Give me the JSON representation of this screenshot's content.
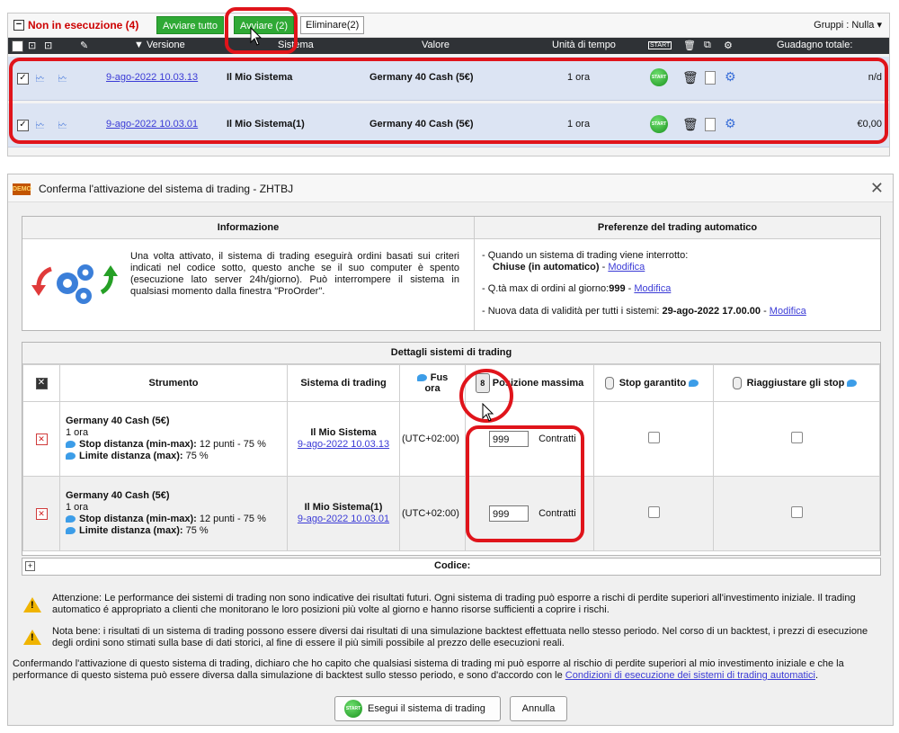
{
  "top": {
    "section_title": "Non in esecuzione (4)",
    "btn_start_all": "Avviare tutto",
    "btn_start": "Avviare (2)",
    "btn_delete": "Eliminare(2)",
    "groups": "Gruppi : Nulla",
    "columns": {
      "version": "▼ Versione",
      "system": "Sistema",
      "value": "Valore",
      "timeframe": "Unità di tempo",
      "start": "START",
      "gain": "Guadagno totale:"
    },
    "rows": [
      {
        "date": "9-ago-2022 10.03.13",
        "system": "Il Mio Sistema",
        "instrument": "Germany 40 Cash (5€)",
        "timeframe": "1 ora",
        "gain": "n/d"
      },
      {
        "date": "9-ago-2022 10.03.01",
        "system": "Il Mio Sistema(1)",
        "instrument": "Germany 40 Cash (5€)",
        "timeframe": "1 ora",
        "gain": "€0,00"
      }
    ]
  },
  "dialog": {
    "title": "Conferma l'attivazione del sistema di trading - ZHTBJ",
    "demo_label": "DEMO",
    "info": {
      "header": "Informazione",
      "text": "Una volta attivato, il sistema di trading eseguirà ordini basati sui criteri indicati nel codice sotto, questo anche se il suo computer è spento (esecuzione lato server 24h/giorno). Può interrompere il sistema in qualsiasi momento dalla finestra \"ProOrder\"."
    },
    "prefs": {
      "header": "Preferenze del trading automatico",
      "line1": "- Quando un sistema di trading viene interrotto:",
      "line1_value": "Chiuse (in automatico)",
      "line2_prefix": "- Q.tà max di ordini al giorno:",
      "line2_value": "999",
      "line3_prefix": "- Nuova data di validità per tutti i sistemi:",
      "line3_value": "29-ago-2022 17.00.00",
      "sep": " - ",
      "modify": "Modifica"
    },
    "details": {
      "header": "Dettagli sistemi di trading",
      "col_instrument": "Strumento",
      "col_system": "Sistema di trading",
      "col_tz_a": "Fus",
      "col_tz_b": "ora",
      "col_max_pos": "Posizione massima",
      "col_stop": "Stop garantito",
      "col_adjust": "Riaggiustare gli stop",
      "rows": [
        {
          "instrument": "Germany 40 Cash (5€)",
          "tf": "1 ora",
          "stop_label": "Stop distanza (min-max):",
          "stop_value": "12 punti - 75 %",
          "limit_label": "Limite distanza (max):",
          "limit_value": "75 %",
          "system": "Il Mio Sistema",
          "date": "9-ago-2022 10.03.13",
          "tz": "(UTC+02:00)",
          "max_pos": "999",
          "unit": "Contratti"
        },
        {
          "instrument": "Germany 40 Cash (5€)",
          "tf": "1 ora",
          "stop_label": "Stop distanza (min-max):",
          "stop_value": "12 punti - 75 %",
          "limit_label": "Limite distanza (max):",
          "limit_value": "75 %",
          "system": "Il Mio Sistema(1)",
          "date": "9-ago-2022 10.03.01",
          "tz": "(UTC+02:00)",
          "max_pos": "999",
          "unit": "Contratti"
        }
      ],
      "code_label": "Codice:"
    },
    "warning1": "Attenzione: Le performance dei sistemi di trading non sono indicative dei risultati futuri. Ogni sistema di trading può esporre a rischi di perdite superiori all'investimento iniziale. Il trading automatico é appropriato a clienti che monitorano le loro posizioni più volte al giorno e hanno risorse sufficienti a coprire i rischi.",
    "warning2": "Nota bene: i risultati di un sistema di trading possono essere diversi dai risultati di una simulazione backtest effettuata nello stesso periodo. Nel corso di un backtest, i prezzi di esecuzione degli ordini sono stimati sulla base di dati storici, al fine di essere il più simili possibile al prezzo delle esecuzioni reali.",
    "confirm_text": "Confermando l'attivazione di questo sistema di trading, dichiaro che ho capito che qualsiasi sistema di trading mi può esporre al rischio di perdite superiori al mio investimento iniziale e che la performance di questo sistema può essere diversa dalla simulazione di backtest sullo stesso periodo, e sono d'accordo con le",
    "conditions_link": "Condizioni di esecuzione dei sistemi di trading automatici",
    "btn_run": "Esegui il sistema di trading",
    "btn_cancel": "Annulla",
    "start_icon_text": "START"
  }
}
